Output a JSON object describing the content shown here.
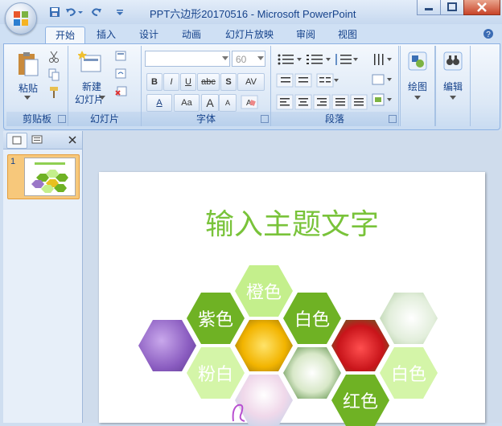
{
  "window": {
    "title": "PPT六边形20170516 - Microsoft PowerPoint"
  },
  "ribbon": {
    "tabs": [
      "开始",
      "插入",
      "设计",
      "动画",
      "幻灯片放映",
      "审阅",
      "视图"
    ],
    "active_tab": "开始",
    "groups": {
      "clipboard": {
        "label": "剪贴板",
        "paste": "粘贴"
      },
      "slides": {
        "label": "幻灯片",
        "new_slide_line1": "新建",
        "new_slide_line2": "幻灯片"
      },
      "font": {
        "label": "字体",
        "font_size": "60",
        "bold": "B",
        "italic": "I",
        "underline": "U",
        "strike": "abc",
        "shadow": "S",
        "spacing": "AV",
        "font_color": "A",
        "case": "Aa",
        "grow": "A",
        "shrink": "A"
      },
      "paragraph": {
        "label": "段落"
      },
      "drawing": {
        "label": "绘图"
      },
      "editing": {
        "label": "编辑"
      }
    }
  },
  "slides_pane": {
    "slide_number": "1"
  },
  "slide": {
    "title": "输入主题文字",
    "hexagons": [
      "橙色",
      "紫色",
      "白色",
      "粉白",
      "白色",
      "红色"
    ]
  },
  "colors": {
    "accent_green": "#6fb224",
    "title_green": "#79c33a",
    "light_green": "#c4ef8c"
  }
}
